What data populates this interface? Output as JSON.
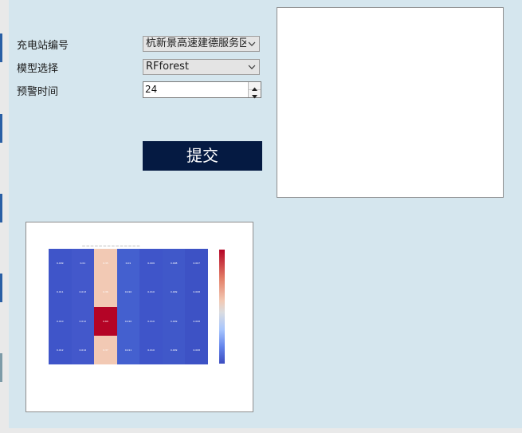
{
  "form": {
    "station_label": "充电站编号",
    "station_value": "杭新景高速建德服务区",
    "model_label": "模型选择",
    "model_value": "RFforest",
    "warning_label": "预警时间",
    "warning_value": "24",
    "submit_label": "提交"
  },
  "colors": {
    "panel_bg": "#d5e6ee",
    "submit_bg": "#051a42",
    "heat_high": "#b40426",
    "heat_mid": "#f2c9b4",
    "heat_low": "#3b4cc0"
  },
  "heatmap": {
    "rows": 4,
    "cols": 7,
    "highlight_col": 2,
    "cells": [
      [
        "0.009",
        "0.01",
        "0.35",
        "0.01",
        "0.009",
        "0.008",
        "0.007"
      ],
      [
        "0.011",
        "0.013",
        "0.36",
        "0.010",
        "0.010",
        "0.009",
        "0.008"
      ],
      [
        "0.010",
        "0.012",
        "0.69",
        "0.010",
        "0.010",
        "0.009",
        "0.008"
      ],
      [
        "0.012",
        "0.014",
        "0.37",
        "0.011",
        "0.010",
        "0.009",
        "0.008"
      ]
    ]
  }
}
